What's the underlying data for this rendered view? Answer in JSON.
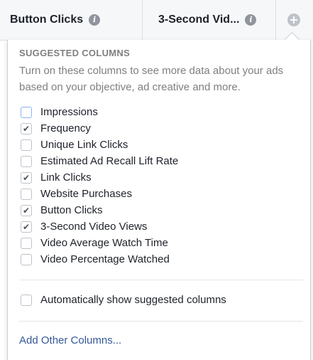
{
  "header": {
    "columns": [
      {
        "label": "Button Clicks"
      },
      {
        "label": "3-Second Vid..."
      }
    ],
    "info_glyph": "i"
  },
  "panel": {
    "section_title": "SUGGESTED COLUMNS",
    "description": "Turn on these columns to see more data about your ads based on your objective, ad creative and more.",
    "options": [
      {
        "label": "Impressions",
        "checked": false
      },
      {
        "label": "Frequency",
        "checked": true
      },
      {
        "label": "Unique Link Clicks",
        "checked": false
      },
      {
        "label": "Estimated Ad Recall Lift Rate",
        "checked": false
      },
      {
        "label": "Link Clicks",
        "checked": true
      },
      {
        "label": "Website Purchases",
        "checked": false
      },
      {
        "label": "Button Clicks",
        "checked": true
      },
      {
        "label": "3-Second Video Views",
        "checked": true
      },
      {
        "label": "Video Average Watch Time",
        "checked": false
      },
      {
        "label": "Video Percentage Watched",
        "checked": false
      }
    ],
    "auto_show": {
      "label": "Automatically show suggested columns",
      "checked": false
    },
    "add_other_label": "Add Other Columns..."
  },
  "icons": {
    "info": "info-icon",
    "add_column": "plus-circle-icon",
    "check": "check-icon"
  },
  "colors": {
    "link": "#365899",
    "muted_text": "#7f7f7f",
    "header_bg": "#f6f7f9"
  }
}
